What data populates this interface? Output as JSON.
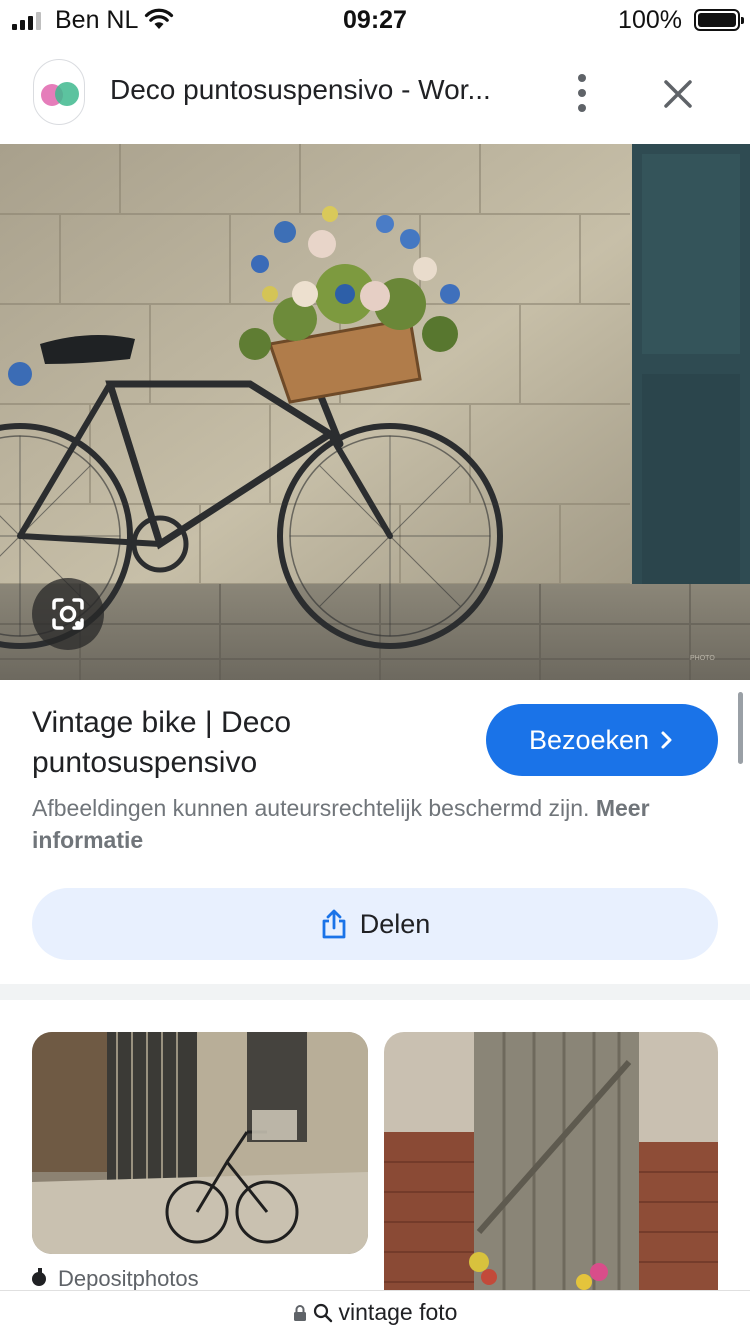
{
  "status_bar": {
    "carrier": "Ben NL",
    "time": "09:27",
    "battery": "100%"
  },
  "header": {
    "page_title": "Deco puntosuspensivo - Wor...",
    "menu_icon": "more-vert-icon",
    "close_icon": "close-icon"
  },
  "hero": {
    "lens_icon": "lens-icon"
  },
  "result": {
    "title": "Vintage bike | Deco puntosuspensivo",
    "visit_label": "Bezoeken",
    "copyright_text": "Afbeeldingen kunnen auteursrechtelijk beschermd zijn.",
    "more_info_label": "Meer informatie",
    "share_label": "Delen"
  },
  "related": {
    "items": [
      {
        "source": "Depositphotos"
      }
    ]
  },
  "url_bar": {
    "text": "vintage foto"
  },
  "colors": {
    "accent": "#1a73e8",
    "share_bg": "#e8f0fe"
  }
}
